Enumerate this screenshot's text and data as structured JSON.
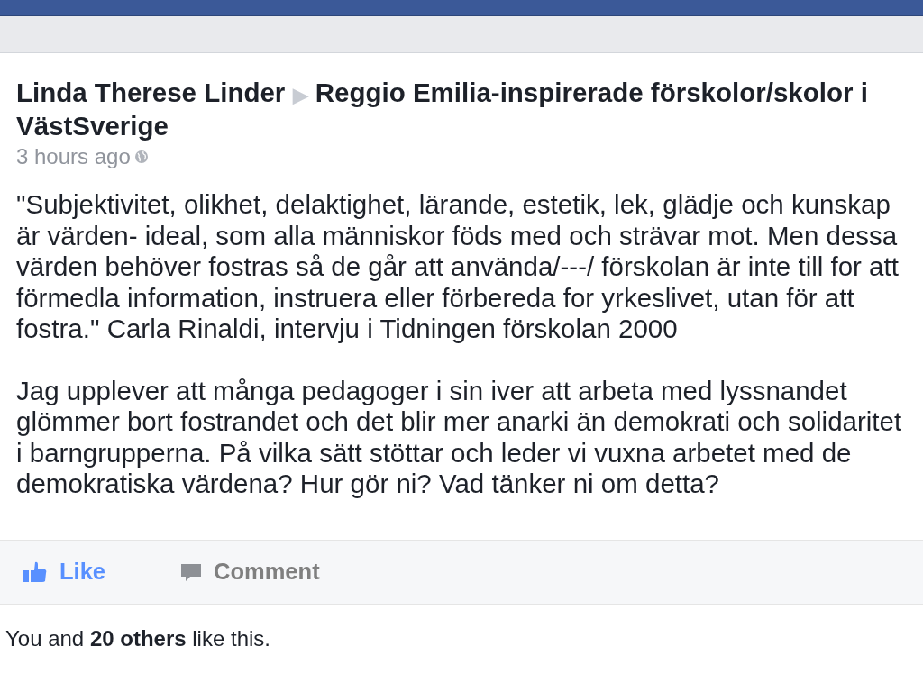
{
  "post": {
    "author": "Linda Therese Linder",
    "separator": "▶",
    "group": "Reggio Emilia-inspirerade förskolor/skolor i VästSverige",
    "time": "3 hours ago",
    "paragraphs": [
      "\"Subjektivitet, olikhet, delaktighet, lärande, estetik, lek, glädje och kunskap är värden- ideal, som alla människor föds med och strävar mot. Men dessa värden behöver fostras så de går att använda/---/ förskolan är inte till for att förmedla information, instruera eller förbereda for yrkeslivet, utan för att fostra.\" Carla Rinaldi, intervju i Tidningen förskolan 2000",
      "Jag upplever att många pedagoger i sin iver att arbeta med lyssnandet glömmer bort fostrandet och det blir mer anarki än demokrati och solidaritet i barngrupperna. På vilka sätt stöttar och leder vi vuxna arbetet med de demokratiska värdena? Hur gör ni? Vad tänker ni om detta?"
    ]
  },
  "actions": [
    {
      "kind": "like",
      "label": "Like",
      "active": true
    },
    {
      "kind": "comment",
      "label": "Comment",
      "active": false
    }
  ],
  "likes_summary": "You and **20 others** like this."
}
